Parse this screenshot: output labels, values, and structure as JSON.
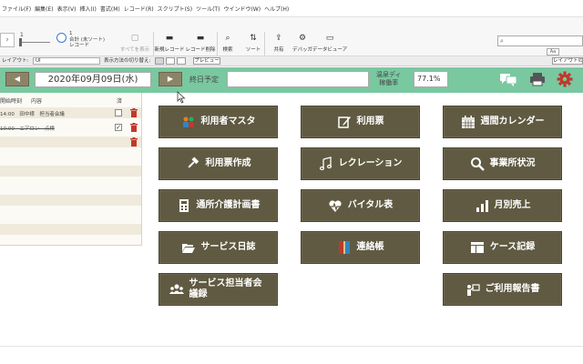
{
  "menu": [
    "ファイル(F)",
    "編集(E)",
    "表示(V)",
    "挿入(I)",
    "書式(M)",
    "レコード(R)",
    "スクリプト(S)",
    "ツール(T)",
    "ウインドウ(W)",
    "ヘルプ(H)"
  ],
  "toolbar": {
    "record_number": "1",
    "record_info_line1": "1",
    "record_info_line2": "合計 (未ソート)",
    "record_info_line3": "レコード",
    "show_all": "すべてを表示",
    "new_record": "新規レコード",
    "delete_record": "レコード削除",
    "find": "検索",
    "sort": "ソート",
    "share": "共有",
    "debug": "デバッガ",
    "data_viewer": "データビューア",
    "aa_label": "Aa"
  },
  "layoutbar": {
    "layout_label": "レイアウト:",
    "layout_value": "UI",
    "view_label": "表示方法の切り替え:",
    "preview": "プレビュー",
    "edit_layout": "レイアウトの編集"
  },
  "header": {
    "date": "2020年09月09日(水)",
    "schedule_label": "終日予定",
    "schedule_value": "",
    "rate_label_line1": "温泉ディ",
    "rate_label_line2": "稼働率",
    "rate_value": "77.1%"
  },
  "list": {
    "col_time": "開始時刻",
    "col_content": "内容",
    "col_done": "済",
    "rows": [
      {
        "text": "14:00　田中様　担当者会議",
        "done": "",
        "strike": false
      },
      {
        "text": "10:00　エアロン　点検",
        "done": "✓",
        "strike": true
      },
      {
        "text": "",
        "done": "",
        "strike": false
      }
    ]
  },
  "buttons": [
    {
      "label": "利用者マスタ"
    },
    {
      "label": "利用票"
    },
    {
      "label": "週間カレンダー"
    },
    {
      "label": "利用票作成"
    },
    {
      "label": "レクレーション"
    },
    {
      "label": "事業所状況"
    },
    {
      "label": "通所介護計画書"
    },
    {
      "label": "バイタル表"
    },
    {
      "label": "月別売上"
    },
    {
      "label": "サービス日誌"
    },
    {
      "label": "連絡帳"
    },
    {
      "label": "ケース記録"
    },
    {
      "label": "サービス担当者会議録"
    },
    {
      "label": "ご利用報告書"
    }
  ],
  "colors": {
    "header_green": "#79c8a0",
    "button_brown": "#605a42",
    "trash_red": "#c0392b",
    "gear_red": "#c0392b"
  }
}
